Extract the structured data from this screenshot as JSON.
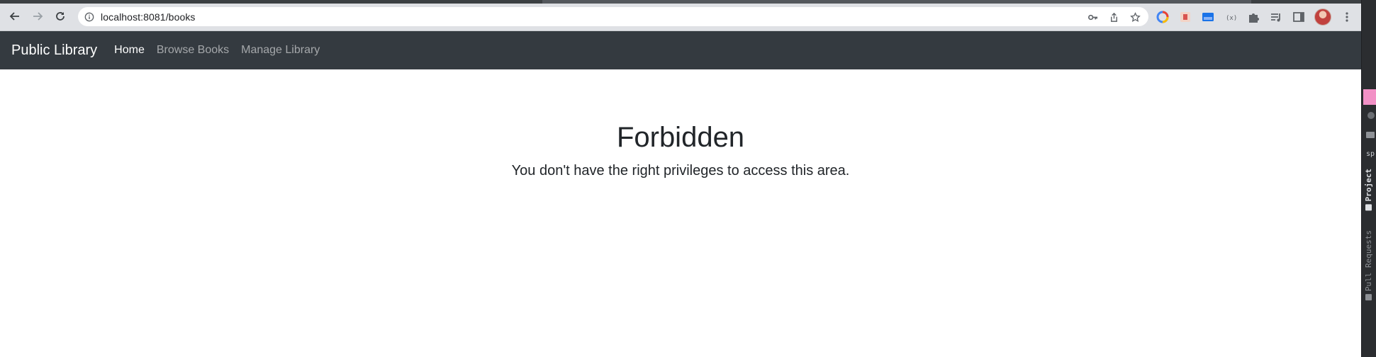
{
  "browser": {
    "url": "localhost:8081/books",
    "icons": {
      "back": "arrow-left-icon",
      "forward": "arrow-right-icon",
      "reload": "reload-icon",
      "site_info": "info-circle-icon",
      "password": "key-icon",
      "share": "share-icon",
      "bookmark": "star-icon"
    },
    "extensions": [
      "color-ring-icon",
      "app-icon",
      "screenshot-icon",
      "code-icon",
      "puzzle-icon",
      "media-queue-icon",
      "side-panel-icon"
    ]
  },
  "navbar": {
    "brand": "Public Library",
    "links": [
      {
        "label": "Home",
        "active": true
      },
      {
        "label": "Browse Books",
        "active": false
      },
      {
        "label": "Manage Library",
        "active": false
      }
    ],
    "background": "#343a40"
  },
  "main": {
    "title": "Forbidden",
    "message": "You don't have the right privileges to access this area."
  },
  "ide_sidebar": {
    "tabs": [
      "Project",
      "Pull Requests"
    ],
    "partial_label": "sp",
    "accent": "#f291c6"
  }
}
